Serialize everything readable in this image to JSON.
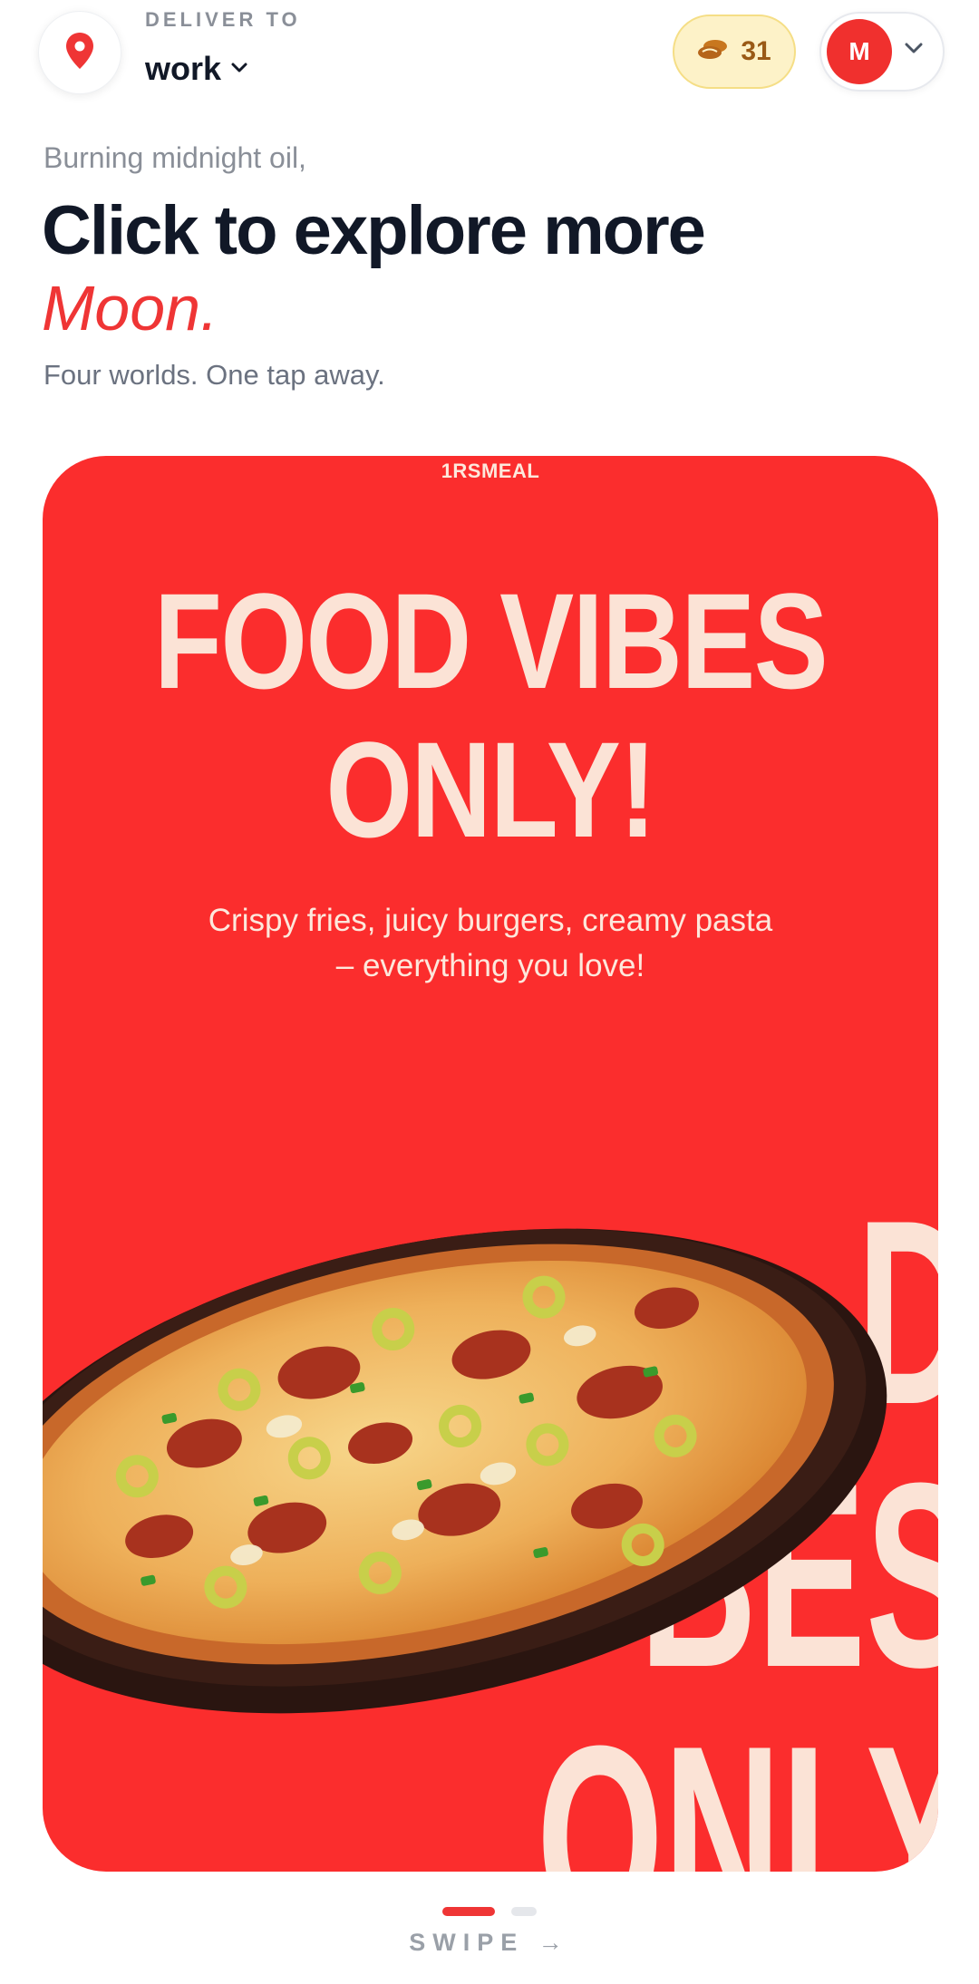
{
  "header": {
    "deliver_label": "DELIVER TO",
    "location": "work",
    "coins": "31",
    "avatar_initial": "M"
  },
  "hero": {
    "greeting": "Burning midnight oil,",
    "headline": "Click to explore more",
    "accent_word": "Moon.",
    "tagline": "Four worlds. One tap away."
  },
  "promo": {
    "brand": "1RSMEAL",
    "title_line1": "FOOD VIBES",
    "title_line2": "ONLY!",
    "subtitle": "Crispy fries, juicy burgers, creamy pasta – everything you love!",
    "background_text": "D\nBES\nONLY"
  },
  "carousel": {
    "swipe_label": "SWIPE →",
    "page_count": 2,
    "active_index": 0
  },
  "colors": {
    "accent": "#ef3535",
    "card_red": "#fb2d2d",
    "cream": "#fbe3d6",
    "coin_bg": "#fdf2c8",
    "coin_text": "#9a5a16"
  },
  "icons": {
    "location": "map-pin-icon",
    "coins": "coins-icon",
    "chevron": "chevron-down-icon"
  }
}
